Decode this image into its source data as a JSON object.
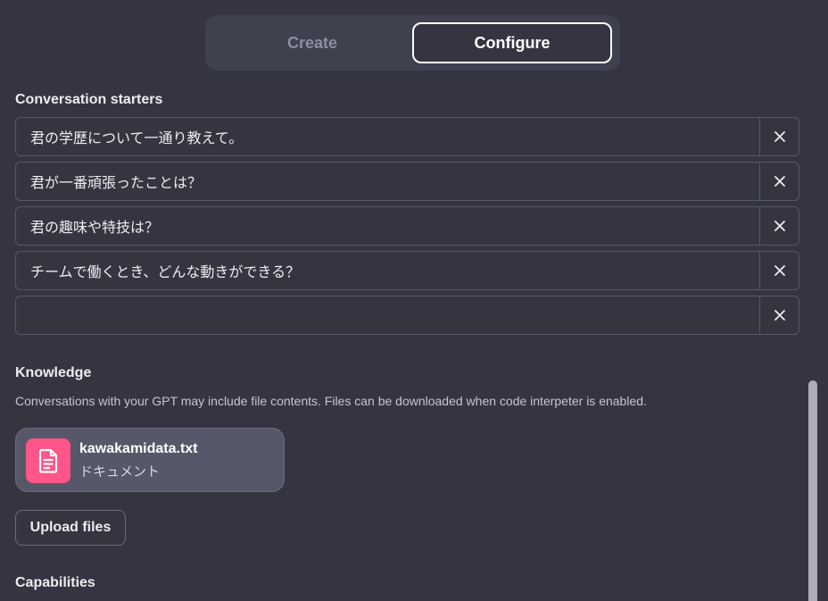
{
  "tabs": {
    "create_label": "Create",
    "configure_label": "Configure",
    "active": "Configure"
  },
  "conversation_starters": {
    "title": "Conversation starters",
    "items": [
      "君の学歴について一通り教えて。",
      "君が一番頑張ったことは？",
      "君の趣味や特技は？",
      "チームで働くとき、どんな動きができる？",
      ""
    ]
  },
  "knowledge": {
    "title": "Knowledge",
    "description": "Conversations with your GPT may include file contents. Files can be downloaded when code interpeter is enabled.",
    "files": [
      {
        "name": "kawakamidata.txt",
        "type": "ドキュメント",
        "icon": "document-icon",
        "icon_color": "#ff5588"
      }
    ],
    "upload_label": "Upload files"
  },
  "capabilities": {
    "title": "Capabilities"
  },
  "colors": {
    "background": "#343541",
    "surface": "#40414f",
    "border": "#565869",
    "file_icon_bg": "#ff5588"
  }
}
